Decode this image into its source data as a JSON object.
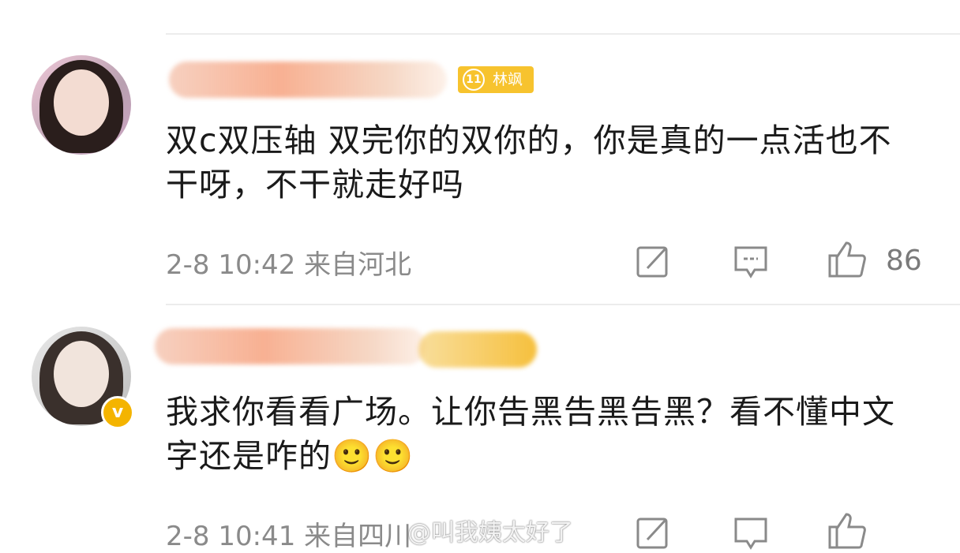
{
  "comments": [
    {
      "author_badge": "林飒",
      "badge_icon": "11",
      "text": "双c双压轴 双完你的双你的，你是真的一点活也不干呀，不干就走好吗",
      "meta": "2-8 10:42 来自河北",
      "likes": "86"
    },
    {
      "text": "我求你看看广场。让你告黑告黑告黑？看不懂中文字还是咋的🙂🙂",
      "meta": "2-8 10:41 来自四川",
      "verified_icon": "v"
    }
  ],
  "watermark": "@叫我姨太好了",
  "colors": {
    "badge": "#f7c32e",
    "verified": "#f4b400",
    "meta": "#8a8a8a"
  }
}
